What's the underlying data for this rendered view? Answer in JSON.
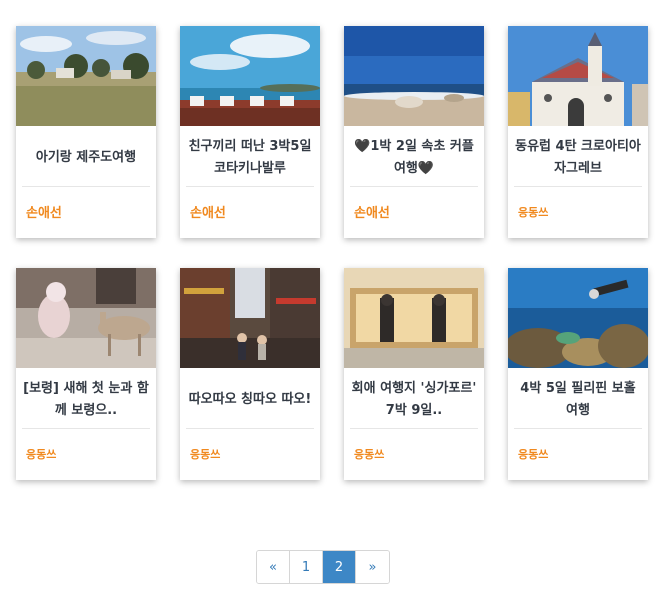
{
  "cards": [
    {
      "title": "아기랑 제주도여행",
      "author": "손애선"
    },
    {
      "title": "친구끼리 떠난 3박5일 코타키나발루",
      "author": "손애선"
    },
    {
      "title": "🖤1박 2일 속초 커플여행🖤",
      "author": "손애선"
    },
    {
      "title": "동유럽 4탄 크로아티아 자그레브",
      "author": "응동쓰"
    },
    {
      "title": "[보령] 새해 첫 눈과 함께 보령으..",
      "author": "응동쓰"
    },
    {
      "title": "따오따오 칭따오 따오!",
      "author": "응동쓰"
    },
    {
      "title": "회애 여행지 '싱가포르' 7박 9일..",
      "author": "응동쓰"
    },
    {
      "title": "4박 5일 필리핀 보홀 여행",
      "author": "응동쓰"
    }
  ],
  "pagination": {
    "prev": "«",
    "pages": [
      "1",
      "2"
    ],
    "active": "2",
    "next": "»"
  },
  "colors": {
    "author": "#f0891f",
    "title": "#333a44",
    "pager_active": "#3d87c6",
    "link": "#337ab7"
  }
}
